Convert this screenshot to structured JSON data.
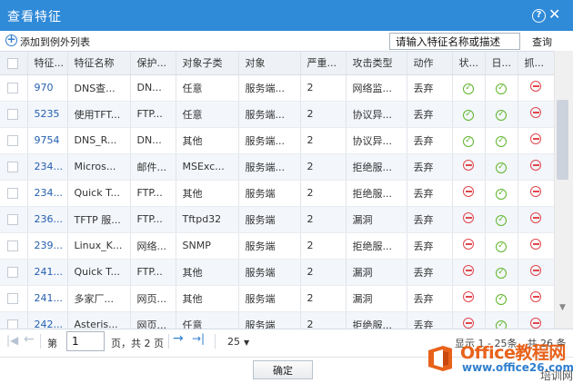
{
  "window": {
    "title": "查看特征",
    "help_glyph": "?",
    "close_glyph": "✕"
  },
  "toolbar": {
    "add_label": "添加到例外列表",
    "search_value": "请输入特征名称或描述",
    "query_label": "查询"
  },
  "columns": [
    "特征...",
    "特征名称",
    "保护...",
    "对象子类",
    "对象",
    "严重...",
    "攻击类型",
    "动作",
    "状...",
    "日...",
    "抓..."
  ],
  "rows": [
    {
      "id": "970",
      "name": "DNS查...",
      "protect": "DN...",
      "subtype": "任意",
      "object": "服务端...",
      "severity": "2",
      "attack": "网络监...",
      "action": "丢弃",
      "status": "ok",
      "log": "ok",
      "capture": "no"
    },
    {
      "id": "5235",
      "name": "使用TFT...",
      "protect": "FTP...",
      "subtype": "任意",
      "object": "服务端...",
      "severity": "2",
      "attack": "协议异...",
      "action": "丢弃",
      "status": "ok",
      "log": "ok",
      "capture": "no"
    },
    {
      "id": "9754",
      "name": "DNS_R...",
      "protect": "DN...",
      "subtype": "其他",
      "object": "服务端...",
      "severity": "2",
      "attack": "协议异...",
      "action": "丢弃",
      "status": "ok",
      "log": "ok",
      "capture": "no"
    },
    {
      "id": "234...",
      "name": "Micros...",
      "protect": "邮件...",
      "subtype": "MSExc...",
      "object": "服务端...",
      "severity": "2",
      "attack": "拒绝服...",
      "action": "丢弃",
      "status": "no",
      "log": "ok",
      "capture": "no"
    },
    {
      "id": "234...",
      "name": "Quick T...",
      "protect": "FTP...",
      "subtype": "其他",
      "object": "服务端",
      "severity": "2",
      "attack": "拒绝服...",
      "action": "丢弃",
      "status": "no",
      "log": "ok",
      "capture": "no"
    },
    {
      "id": "236...",
      "name": "TFTP 服...",
      "protect": "FTP...",
      "subtype": "Tftpd32",
      "object": "服务端",
      "severity": "2",
      "attack": "漏洞",
      "action": "丢弃",
      "status": "no",
      "log": "ok",
      "capture": "no"
    },
    {
      "id": "239...",
      "name": "Linux_K...",
      "protect": "网络...",
      "subtype": "SNMP",
      "object": "服务端",
      "severity": "2",
      "attack": "拒绝服...",
      "action": "丢弃",
      "status": "no",
      "log": "ok",
      "capture": "no"
    },
    {
      "id": "241...",
      "name": "Quick T...",
      "protect": "FTP...",
      "subtype": "其他",
      "object": "服务端",
      "severity": "2",
      "attack": "漏洞",
      "action": "丢弃",
      "status": "no",
      "log": "ok",
      "capture": "no"
    },
    {
      "id": "241...",
      "name": "多家厂...",
      "protect": "网页...",
      "subtype": "其他",
      "object": "服务端",
      "severity": "2",
      "attack": "漏洞",
      "action": "丢弃",
      "status": "no",
      "log": "ok",
      "capture": "no"
    },
    {
      "id": "242...",
      "name": "Asteris...",
      "protect": "网页...",
      "subtype": "任意",
      "object": "服务端",
      "severity": "2",
      "attack": "拒绝服...",
      "action": "丢弃",
      "status": "no",
      "log": "ok",
      "capture": "no"
    }
  ],
  "pager": {
    "first_glyph": "|◀",
    "prev_glyph": "←",
    "next_glyph": "→",
    "last_glyph": "→|",
    "page_label": "第",
    "page_value": "1",
    "total_label": "页，共 2 页",
    "page_size": "25",
    "display_info": "显示 1 - 25条，共 26 条"
  },
  "footer": {
    "ok_label": "确定"
  },
  "watermark": {
    "brand": "Office教程网",
    "url": "www.office26.com",
    "cn": "培训网"
  },
  "colors": {
    "titlebar": "#2f8ad8",
    "ok_icon": "#5fb52c",
    "no_icon": "#e0474c",
    "link_id": "#2560b0",
    "brand": "#e8621b"
  },
  "icons": {
    "status_ok": "check-circle-icon",
    "status_no": "minus-circle-icon"
  }
}
